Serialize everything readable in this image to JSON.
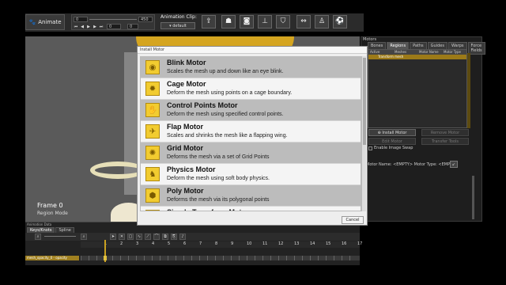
{
  "toolbar": {
    "animate_label": "Animate",
    "frame_start": "0",
    "frame_end": "450",
    "current_frame": "0",
    "loop_count": "0",
    "clip_label": "Animation Clip:",
    "clip_value": "default",
    "tools": [
      "export-icon",
      "bone-icon",
      "camera-icon",
      "rig-icon",
      "bucket-icon",
      "resize-icon",
      "run-icon",
      "soccer-icon"
    ]
  },
  "viewport": {
    "frame_label": "Frame 0",
    "mode_label": "Region Mode"
  },
  "motors_panel": {
    "title": "Motors",
    "tabs": [
      "Bones",
      "Regions",
      "Paths",
      "Guides",
      "Warps",
      "Force Fields"
    ],
    "active_tab": "Regions",
    "headers": [
      "Active",
      "Meshes",
      "Motor Name",
      "Motor Type"
    ],
    "row": "Transform mesh",
    "install_label": "Install Motor",
    "remove_label": "Remove Motor",
    "edit_label": "Edit Motor",
    "transfer_label": "Transfer Tools",
    "image_swap_label": "Enable Image Swap",
    "motor_info": "Motor Name: <EMPTY> Motor Type: <EMPTY>"
  },
  "timeline": {
    "title": "Animation Data",
    "tabs": [
      "Keys/Knots",
      "Spline"
    ],
    "track_label": "mesh_opacity_0 - opacity",
    "ruler": [
      "1",
      "2",
      "3",
      "4",
      "5",
      "6",
      "7",
      "8",
      "9",
      "10",
      "11",
      "12",
      "13",
      "14",
      "15",
      "16",
      "17"
    ]
  },
  "dialog": {
    "title": "Install Motor",
    "cancel_label": "Cancel",
    "motors": [
      {
        "name": "Blink Motor",
        "desc": "Scales the mesh up and down like an eye blink.",
        "icon": "eye-icon",
        "glyph": "◉"
      },
      {
        "name": "Cage Motor",
        "desc": "Deform the mesh using points on a cage boundary.",
        "icon": "cage-icon",
        "glyph": "✹"
      },
      {
        "name": "Control Points Motor",
        "desc": "Deform the mesh using specified control points.",
        "icon": "hand-icon",
        "glyph": "✋"
      },
      {
        "name": "Flap Motor",
        "desc": "Scales and shrinks the mesh like a flapping wing.",
        "icon": "wing-icon",
        "glyph": "✈"
      },
      {
        "name": "Grid Motor",
        "desc": "Deforms the mesh via a set of Grid Points",
        "icon": "grid-icon",
        "glyph": "✺"
      },
      {
        "name": "Physics Motor",
        "desc": "Deform the mesh using soft body physics.",
        "icon": "physics-icon",
        "glyph": "♞"
      },
      {
        "name": "Poly Motor",
        "desc": "Deforms the mesh via its polygonal points",
        "icon": "poly-icon",
        "glyph": "⬢"
      },
      {
        "name": "Simple Transform Motor",
        "desc": "",
        "icon": "transform-icon",
        "glyph": "✦"
      }
    ]
  }
}
